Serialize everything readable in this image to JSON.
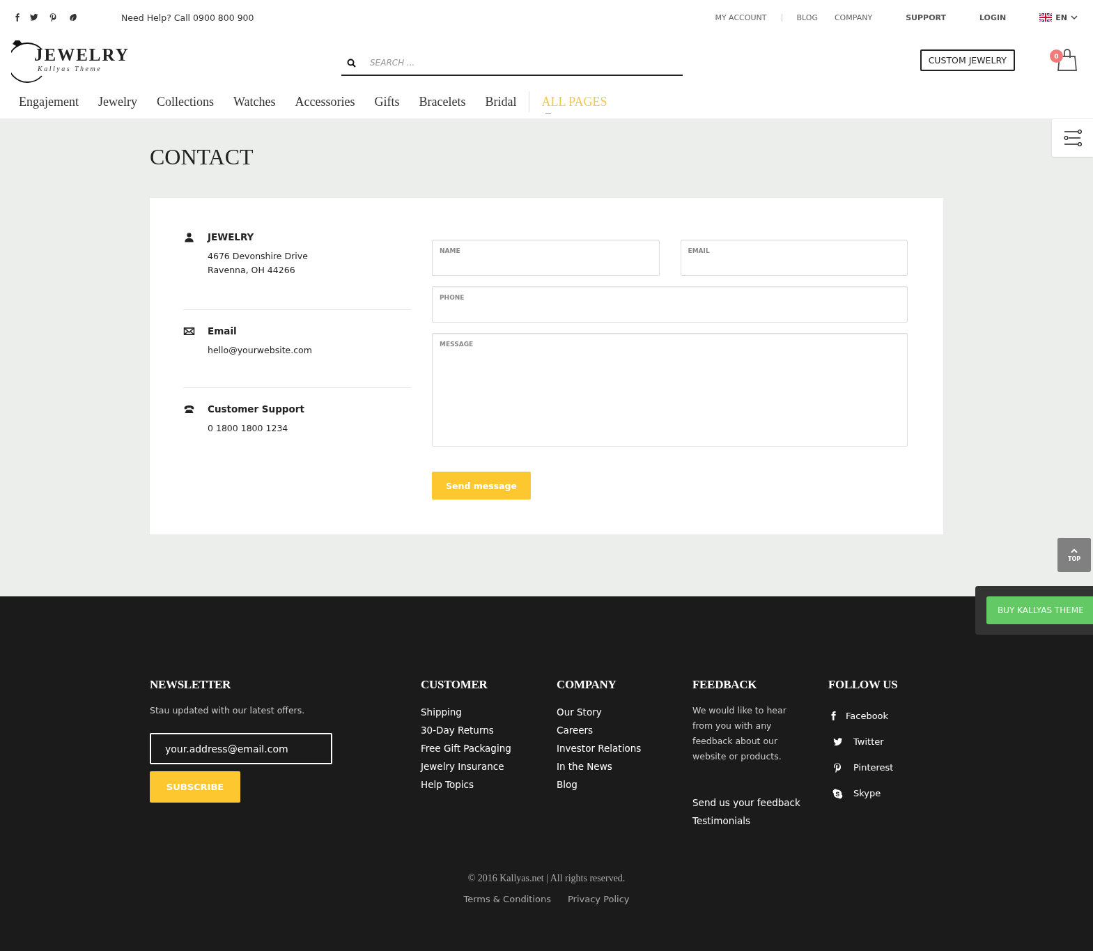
{
  "top_bar": {
    "help_text": "Need Help? Call 0900 800 900",
    "social": [
      {
        "kind": "facebook"
      },
      {
        "kind": "twitter"
      },
      {
        "kind": "pinterest"
      },
      {
        "kind": "leaf"
      }
    ],
    "links": [
      {
        "label": "MY ACCOUNT",
        "bold": false
      },
      {
        "label": "BLOG",
        "bold": false
      },
      {
        "label": "COMPANY",
        "bold": false
      },
      {
        "label": "SUPPORT",
        "bold": true
      },
      {
        "label": "LOGIN",
        "bold": true
      }
    ],
    "language": "EN"
  },
  "header": {
    "logo_title": "JEWELRY",
    "logo_subtitle": "Kallyas Theme",
    "search": {
      "placeholder": "SEARCH ..."
    },
    "custom_button": "CUSTOM JEWELRY",
    "cart_count": "0"
  },
  "nav": [
    {
      "label": "Engajement",
      "selected": false
    },
    {
      "label": "Jewelry",
      "selected": false
    },
    {
      "label": "Collections",
      "selected": false
    },
    {
      "label": "Watches",
      "selected": false
    },
    {
      "label": "Accessories",
      "selected": false
    },
    {
      "label": "Gifts",
      "selected": false
    },
    {
      "label": "Bracelets",
      "selected": false
    },
    {
      "label": "Bridal",
      "selected": false
    },
    {
      "label": "ALL PAGES",
      "selected": true
    }
  ],
  "page_title": "CONTACT",
  "contact_info": [
    {
      "kind": "address",
      "title": "JEWELRY",
      "lines": [
        "4676 Devonshire Drive",
        "Ravenna, OH 44266"
      ]
    },
    {
      "kind": "email",
      "title": "Email",
      "lines": [
        "hello@yourwebsite.com"
      ]
    },
    {
      "kind": "phone",
      "title": "Customer Support",
      "lines": [
        "0 1800 1800 1234"
      ]
    }
  ],
  "form": {
    "fields": [
      {
        "label": "NAME",
        "kind": "half"
      },
      {
        "label": "EMAIL",
        "kind": "half"
      },
      {
        "label": "PHONE",
        "kind": "full"
      },
      {
        "label": "MESSAGE",
        "kind": "textarea"
      }
    ],
    "submit": "Send message"
  },
  "footer": {
    "newsletter": {
      "title": "NEWSLETTER",
      "text": "Stau updated with our latest offers.",
      "placeholder": "your.address@email.com",
      "button": "SUBSCRIBE"
    },
    "customer": {
      "title": "CUSTOMER",
      "links": [
        "Shipping",
        "30-Day Returns",
        "Free Gift Packaging",
        "Jewelry Insurance",
        "Help Topics"
      ]
    },
    "company": {
      "title": "COMPANY",
      "links": [
        "Our Story",
        "Careers",
        "Investor Relations",
        "In the News",
        "Blog"
      ]
    },
    "feedback": {
      "title": "FEEDBACK",
      "text": "We would like to hear from you with any feedback about our website or products.",
      "links": [
        "Send us your feedback",
        "Testimonials"
      ]
    },
    "follow": {
      "title": "FOLLOW US",
      "items": [
        {
          "kind": "facebook",
          "label": "Facebook"
        },
        {
          "kind": "twitter",
          "label": "Twitter"
        },
        {
          "kind": "pinterest",
          "label": "Pinterest"
        },
        {
          "kind": "skype",
          "label": "Skype"
        }
      ]
    },
    "copyright": "© 2016 Kallyas.net | All rights reserved.",
    "legal_links": [
      "Terms & Conditions",
      "Privacy Policy"
    ]
  },
  "floating": {
    "top_label": "TOP",
    "buy_label": "BUY KALLYAS THEME"
  }
}
